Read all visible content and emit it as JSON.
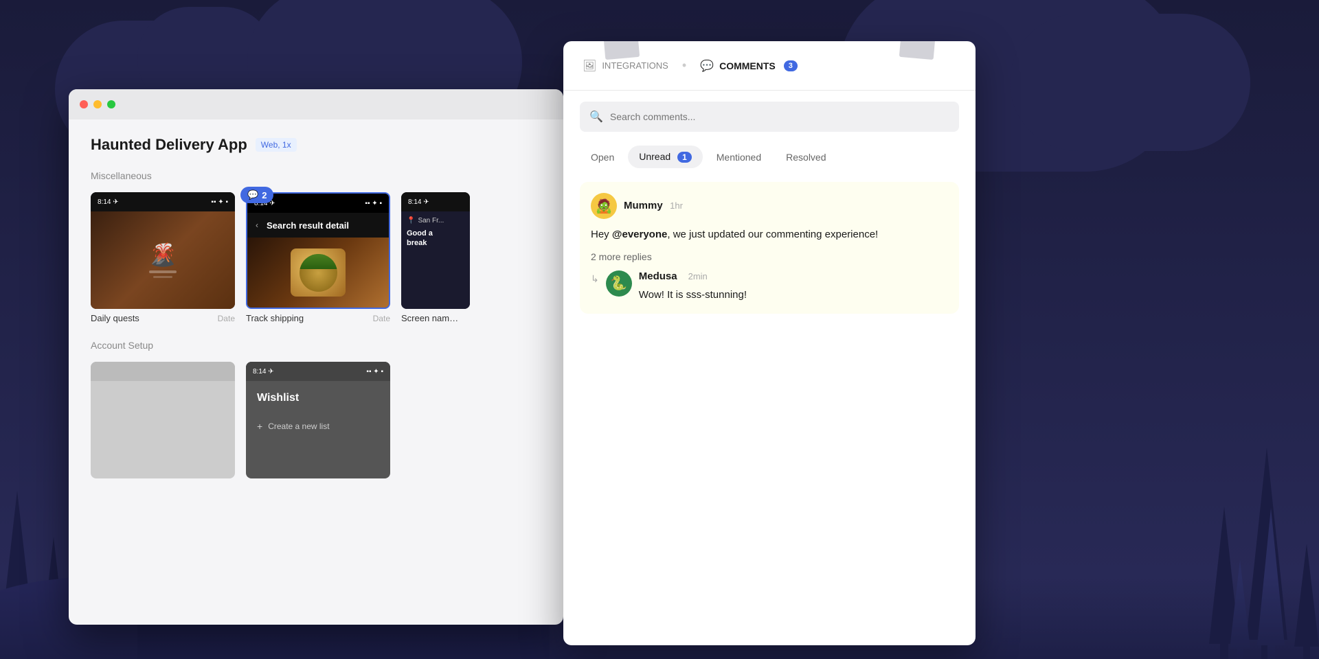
{
  "background": {
    "color": "#1a1b3a"
  },
  "window": {
    "title": "Haunted Delivery App",
    "badge": "Web, 1x",
    "sections": [
      {
        "label": "Miscellaneous",
        "screens": [
          {
            "name": "Daily quests",
            "date": "Date",
            "hasCommentBadge": false
          },
          {
            "name": "Track shipping",
            "date": "Date",
            "hasCommentBadge": true,
            "badgeCount": "2",
            "screenTitle": "Search result detail"
          },
          {
            "name": "Screen nam…",
            "date": "",
            "partial": true
          }
        ]
      },
      {
        "label": "Account Setup",
        "screens": [
          {
            "name": "Wishlist",
            "date": "",
            "hasCommentBadge": false
          },
          {
            "name": "",
            "date": "",
            "hasCommentBadge": false
          }
        ]
      }
    ]
  },
  "comments_panel": {
    "tabs": [
      {
        "id": "integrations",
        "label": "INTEGRATIONS",
        "active": false
      },
      {
        "id": "comments",
        "label": "COMMENTS",
        "active": true,
        "count": "3"
      }
    ],
    "search": {
      "placeholder": "Search comments..."
    },
    "filters": [
      {
        "id": "open",
        "label": "Open",
        "active": false,
        "count": null
      },
      {
        "id": "unread",
        "label": "Unread",
        "active": true,
        "count": "1"
      },
      {
        "id": "mentioned",
        "label": "Mentioned",
        "active": false,
        "count": null
      },
      {
        "id": "resolved",
        "label": "Resolved",
        "active": false,
        "count": null
      }
    ],
    "threads": [
      {
        "id": "thread-1",
        "author": "Mummy",
        "time": "1hr",
        "avatar_emoji": "🧟",
        "avatar_color": "#f5c842",
        "body_prefix": "Hey ",
        "mention": "@everyone",
        "body_suffix": ", we just updated our commenting experience!",
        "more_replies_text": "2 more replies",
        "replies": [
          {
            "author": "Medusa",
            "time": "2min",
            "avatar_emoji": "🐍",
            "avatar_color": "#2d8a4e",
            "body": "Wow! It is sss-stunning!"
          }
        ]
      }
    ]
  }
}
